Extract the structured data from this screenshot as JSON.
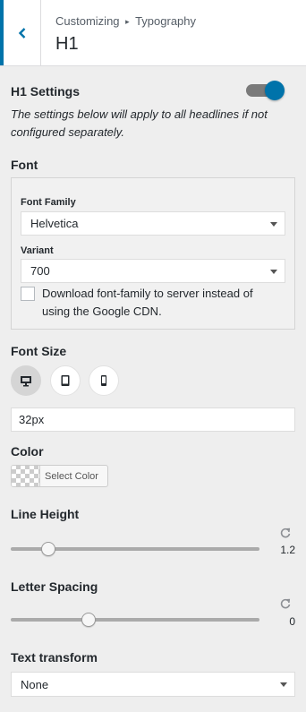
{
  "header": {
    "breadcrumb_root": "Customizing",
    "breadcrumb_separator": "▸",
    "breadcrumb_current": "Typography",
    "title": "H1",
    "accent_color": "#0073aa"
  },
  "h1_settings": {
    "label": "H1 Settings",
    "enabled": true,
    "description": "The settings below will apply to all headlines if not configured separately."
  },
  "font": {
    "label": "Font",
    "family_label": "Font Family",
    "family_value": "Helvetica",
    "variant_label": "Variant",
    "variant_value": "700",
    "download_checked": false,
    "download_label": "Download font-family to server instead of using the Google CDN."
  },
  "font_size": {
    "label": "Font Size",
    "devices": [
      "desktop-icon",
      "tablet-icon",
      "mobile-icon"
    ],
    "active_device": "desktop",
    "value": "32px"
  },
  "color": {
    "label": "Color",
    "button_label": "Select Color"
  },
  "line_height": {
    "label": "Line Height",
    "value": "1.2",
    "fraction": 0.13
  },
  "letter_spacing": {
    "label": "Letter Spacing",
    "value": "0",
    "fraction": 0.3
  },
  "text_transform": {
    "label": "Text transform",
    "value": "None"
  }
}
